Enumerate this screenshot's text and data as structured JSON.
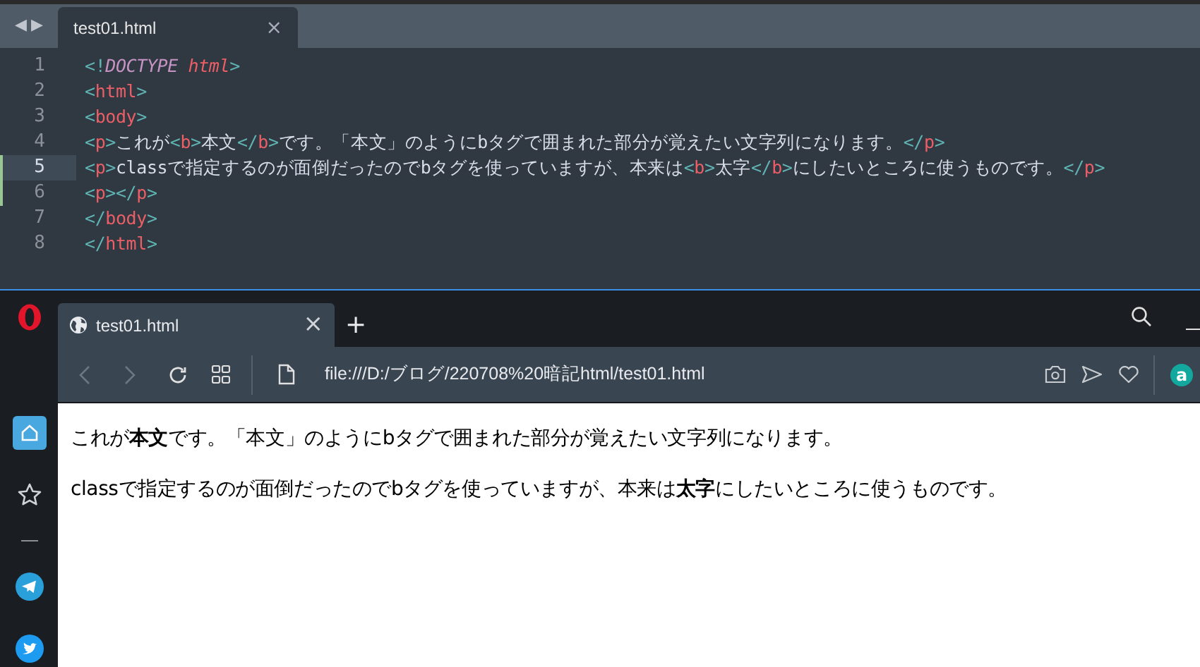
{
  "editor": {
    "nav": [
      "◀",
      "▶"
    ],
    "tabs": [
      {
        "label": "test01.html",
        "selected": true,
        "close": "×"
      }
    ],
    "lines": [
      {
        "number": "1",
        "current": false,
        "modified": false,
        "tokens": [
          {
            "kind": "punct",
            "text": "<!"
          },
          {
            "kind": "doctype",
            "text": "DOCTYPE"
          },
          {
            "kind": "attr",
            "text": " html"
          },
          {
            "kind": "punct",
            "text": ">"
          }
        ]
      },
      {
        "number": "2",
        "current": false,
        "modified": false,
        "tokens": [
          {
            "kind": "punct",
            "text": "<"
          },
          {
            "kind": "tag",
            "text": "html"
          },
          {
            "kind": "punct",
            "text": ">"
          }
        ]
      },
      {
        "number": "3",
        "current": false,
        "modified": false,
        "tokens": [
          {
            "kind": "punct",
            "text": "<"
          },
          {
            "kind": "tag",
            "text": "body"
          },
          {
            "kind": "punct",
            "text": ">"
          }
        ]
      },
      {
        "number": "4",
        "current": false,
        "modified": false,
        "tokens": [
          {
            "kind": "punct",
            "text": "<"
          },
          {
            "kind": "tag",
            "text": "p"
          },
          {
            "kind": "punct",
            "text": ">"
          },
          {
            "kind": "text",
            "text": "これが"
          },
          {
            "kind": "punct",
            "text": "<"
          },
          {
            "kind": "tag",
            "text": "b"
          },
          {
            "kind": "punct",
            "text": ">"
          },
          {
            "kind": "text",
            "text": "本文"
          },
          {
            "kind": "punct",
            "text": "</"
          },
          {
            "kind": "tag",
            "text": "b"
          },
          {
            "kind": "punct",
            "text": ">"
          },
          {
            "kind": "text",
            "text": "です。「本文」のようにbタグで囲まれた部分が覚えたい文字列になります。"
          },
          {
            "kind": "punct",
            "text": "</"
          },
          {
            "kind": "tag",
            "text": "p"
          },
          {
            "kind": "punct",
            "text": ">"
          }
        ]
      },
      {
        "number": "5",
        "current": true,
        "modified": true,
        "tokens": [
          {
            "kind": "punct",
            "text": "<"
          },
          {
            "kind": "tag",
            "text": "p"
          },
          {
            "kind": "punct",
            "text": ">"
          },
          {
            "kind": "text",
            "text": "classで指定するのが面倒だったのでbタグを使っていますが、本来は"
          },
          {
            "kind": "punct",
            "text": "<"
          },
          {
            "kind": "tag",
            "text": "b"
          },
          {
            "kind": "punct",
            "text": ">"
          },
          {
            "kind": "text",
            "text": "太字"
          },
          {
            "kind": "punct",
            "text": "</"
          },
          {
            "kind": "tag",
            "text": "b"
          },
          {
            "kind": "punct",
            "text": ">"
          },
          {
            "kind": "text",
            "text": "にしたいところに使うものです。"
          },
          {
            "kind": "punct",
            "text": "</"
          },
          {
            "kind": "tag",
            "text": "p"
          },
          {
            "kind": "punct",
            "text": ">"
          }
        ]
      },
      {
        "number": "6",
        "current": false,
        "modified": true,
        "tokens": [
          {
            "kind": "punct",
            "text": "<"
          },
          {
            "kind": "tag",
            "text": "p"
          },
          {
            "kind": "punct",
            "text": "></"
          },
          {
            "kind": "tag",
            "text": "p"
          },
          {
            "kind": "punct",
            "text": ">"
          }
        ]
      },
      {
        "number": "7",
        "current": false,
        "modified": false,
        "tokens": [
          {
            "kind": "punct",
            "text": "</"
          },
          {
            "kind": "tag",
            "text": "body"
          },
          {
            "kind": "punct",
            "text": ">"
          }
        ]
      },
      {
        "number": "8",
        "current": false,
        "modified": false,
        "tokens": [
          {
            "kind": "punct",
            "text": "</"
          },
          {
            "kind": "tag",
            "text": "html"
          },
          {
            "kind": "punct",
            "text": ">"
          }
        ]
      }
    ]
  },
  "browser": {
    "sidebar": [
      {
        "kind": "home",
        "selected": true
      },
      {
        "kind": "bookmarks",
        "selected": false
      },
      {
        "kind": "divider"
      },
      {
        "kind": "telegram",
        "selected": false
      },
      {
        "kind": "twitter",
        "selected": false
      }
    ],
    "tabs": [
      {
        "label": "test01.html",
        "selected": true,
        "close": "×"
      }
    ],
    "new_tab": "+",
    "address": "file:///D:/ブログ/220708%20暗記html/test01.html",
    "extension_badge": "a",
    "paragraphs": [
      "これが**本文**です。「本文」のようにbタグで囲まれた部分が覚えたい文字列になります。",
      "classで指定するのが面倒だったのでbタグを使っていますが、本来は**太字**にしたいところに使うものです。"
    ]
  }
}
